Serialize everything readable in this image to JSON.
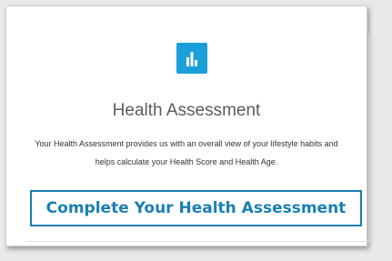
{
  "card": {
    "icon": "bar-chart-icon",
    "icon_color": "#1a9fd9",
    "title": "Health Assessment",
    "description": "Your Health Assessment provides us with an overall view of your lifestyle habits and helps calculate your Health Score and Health Age.",
    "cta_label": "Complete Your Health Assessment",
    "cta_color": "#1b7fb2"
  }
}
